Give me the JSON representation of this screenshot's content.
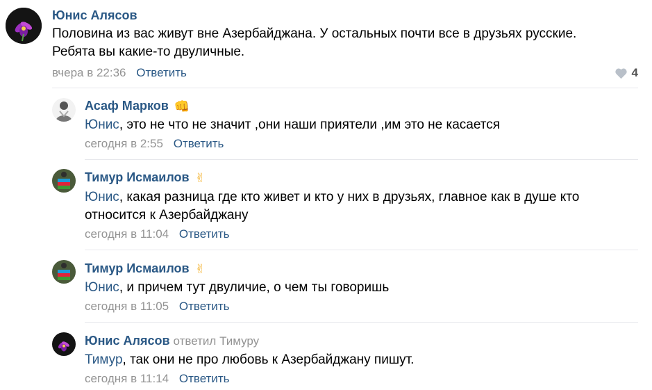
{
  "comments": [
    {
      "author": "Юнис Алясов",
      "text": "Половина из вас живут вне Азербайджана. У остальных почти все в друзьях русские. Ребята вы какие-то двуличные.",
      "time": "вчера в 22:36",
      "reply_label": "Ответить",
      "likes": "4"
    }
  ],
  "replies": [
    {
      "author": "Асаф Марков",
      "emoji": "👊",
      "mention": "Юнис",
      "text": ", это не что не значит ,они наши приятели ,им это не касается",
      "time": "сегодня в 2:55",
      "reply_label": "Ответить"
    },
    {
      "author": "Тимур Исмаилов",
      "emoji": "✌",
      "mention": "Юнис",
      "text": ", какая разница где кто живет и кто у них в друзьях, главное как в душе кто относится к Азербайджану",
      "time": "сегодня в 11:04",
      "reply_label": "Ответить"
    },
    {
      "author": "Тимур Исмаилов",
      "emoji": "✌",
      "mention": "Юнис",
      "text": ", и причем тут двуличие, о чем ты говоришь",
      "time": "сегодня в 11:05",
      "reply_label": "Ответить"
    },
    {
      "author": "Юнис Алясов",
      "replied_to": "ответил Тимуру",
      "mention": "Тимур",
      "text": ", так они не про любовь к Азербайджану пишут.",
      "time": "сегодня в 11:14",
      "reply_label": "Ответить"
    }
  ],
  "colors": {
    "link": "#2a5885",
    "meta": "#939393",
    "divider": "#e7e8ec"
  }
}
